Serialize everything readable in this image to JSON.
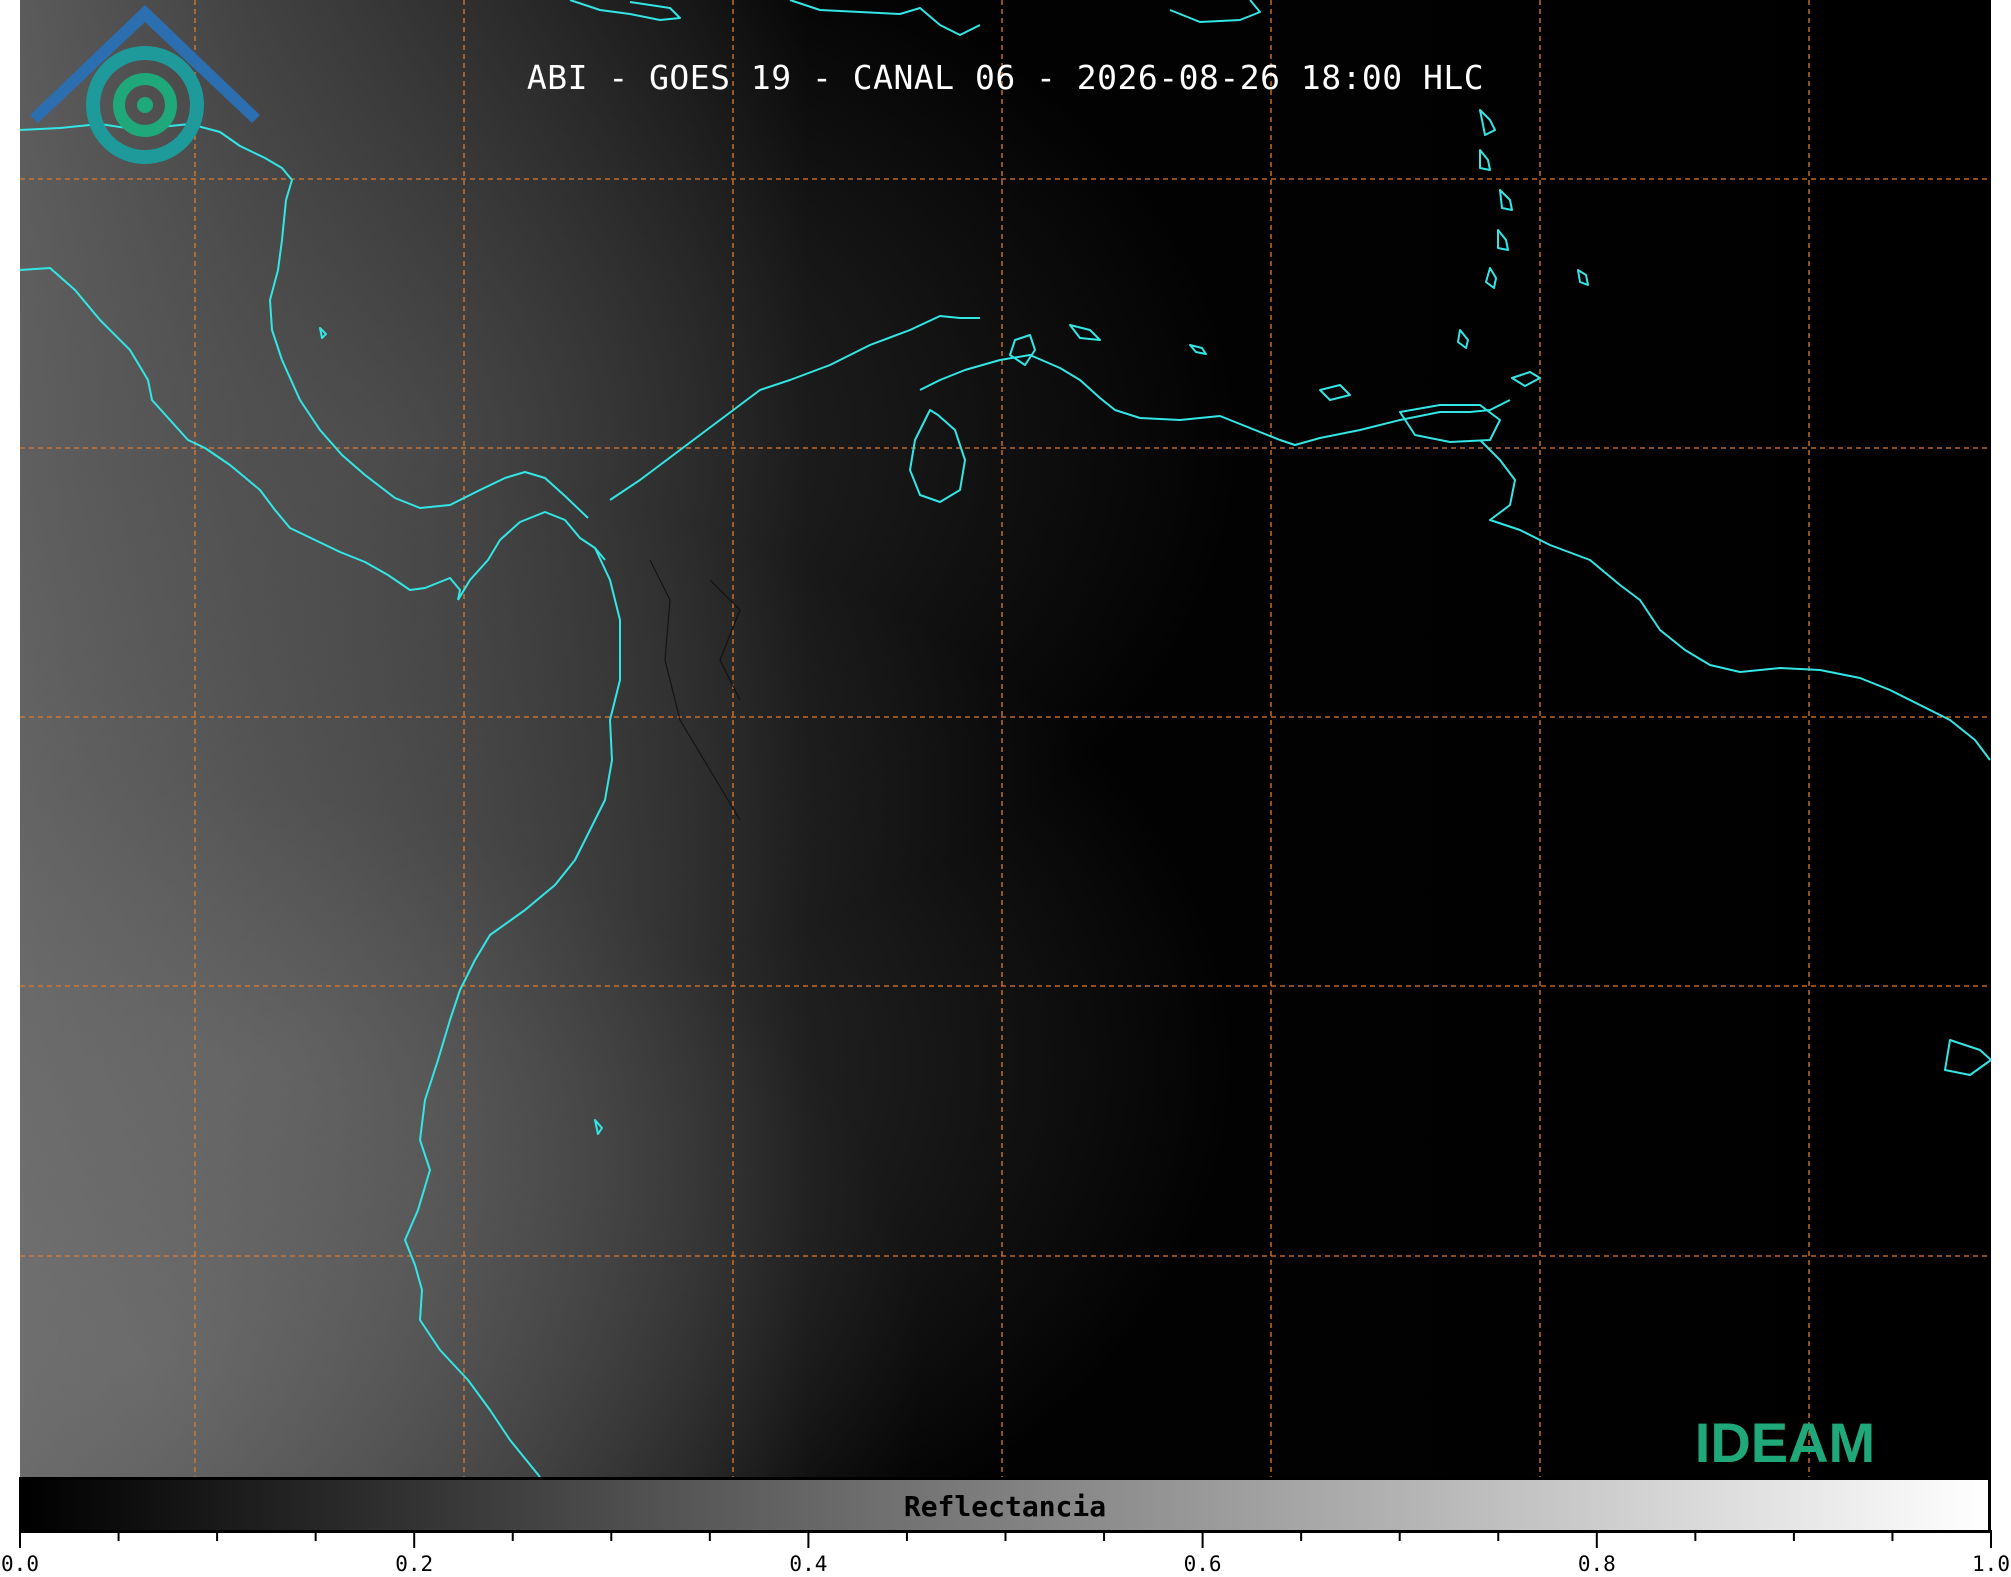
{
  "map": {
    "title": "ABI - GOES 19 - CANAL 06 - 2026-08-26 18:00 HLC",
    "coastline_color": "#33e6e6",
    "gridline_color": "#e07a2e",
    "background": "satellite reflectance, grayscale"
  },
  "logo": {
    "text": "IDEAM",
    "colors": [
      "#2b6fb0",
      "#1fa879"
    ]
  },
  "colorbar": {
    "label": "Reflectancia",
    "range": [
      0.0,
      1.0
    ],
    "colormap": "grayscale black-to-white",
    "tick_labels": [
      "0.0",
      "0.2",
      "0.4",
      "0.6",
      "0.8",
      "1.0"
    ]
  }
}
